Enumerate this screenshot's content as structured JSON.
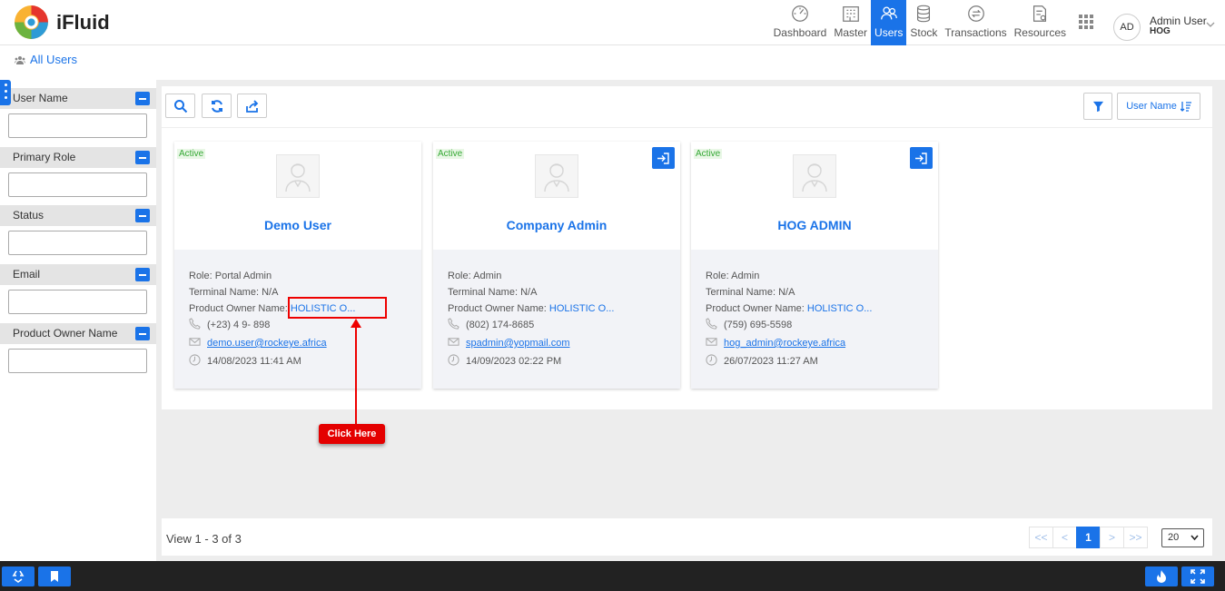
{
  "app": {
    "brand": "iFluid"
  },
  "nav": [
    {
      "label": "Dashboard",
      "icon": "dashboard-icon",
      "active": false
    },
    {
      "label": "Master",
      "icon": "building-icon",
      "active": false
    },
    {
      "label": "Users",
      "icon": "users-icon",
      "active": true
    },
    {
      "label": "Stock",
      "icon": "stock-icon",
      "active": false
    },
    {
      "label": "Transactions",
      "icon": "transactions-icon",
      "active": false
    },
    {
      "label": "Resources",
      "icon": "resources-icon",
      "active": false
    }
  ],
  "user": {
    "initials": "AD",
    "name": "Admin User",
    "org": "HOG"
  },
  "breadcrumb": {
    "label": "All Users"
  },
  "filters": [
    {
      "label": "User Name",
      "value": ""
    },
    {
      "label": "Primary Role",
      "value": ""
    },
    {
      "label": "Status",
      "value": ""
    },
    {
      "label": "Email",
      "value": ""
    },
    {
      "label": "Product Owner Name",
      "value": ""
    }
  ],
  "toolbar": {
    "sort_label": "User Name"
  },
  "cards": [
    {
      "status": "Active",
      "name": "Demo User",
      "role_label": "Role: Portal Admin",
      "terminal_label": "Terminal Name: N/A",
      "owner_prefix": "Product Owner Name: ",
      "owner_link": "HOLISTIC O...",
      "phone": "(+23) 4 9- 898",
      "email": "demo.user@rockeye.africa",
      "date": "14/08/2023 11:41 AM",
      "has_login": false
    },
    {
      "status": "Active",
      "name": "Company Admin",
      "role_label": "Role: Admin",
      "terminal_label": "Terminal Name: N/A",
      "owner_prefix": "Product Owner Name: ",
      "owner_link": "HOLISTIC O...",
      "phone": "(802) 174-8685",
      "email": "spadmin@yopmail.com",
      "date": "14/09/2023 02:22 PM",
      "has_login": true
    },
    {
      "status": "Active",
      "name": "HOG ADMIN",
      "role_label": "Role: Admin",
      "terminal_label": "Terminal Name: N/A",
      "owner_prefix": "Product Owner Name: ",
      "owner_link": "HOLISTIC O...",
      "phone": "(759) 695-5598",
      "email": "hog_admin@rockeye.africa",
      "date": "26/07/2023 11:27 AM",
      "has_login": true
    }
  ],
  "pagination": {
    "view_text": "View 1 - 3 of 3",
    "current_page": "1",
    "page_size": "20",
    "first": "<<",
    "prev": "<",
    "next": ">",
    "last": ">>"
  },
  "annotation": {
    "label": "Click Here"
  },
  "colors": {
    "accent": "#1a73e8",
    "annotation": "#e40000",
    "active_status": "#36a936"
  }
}
